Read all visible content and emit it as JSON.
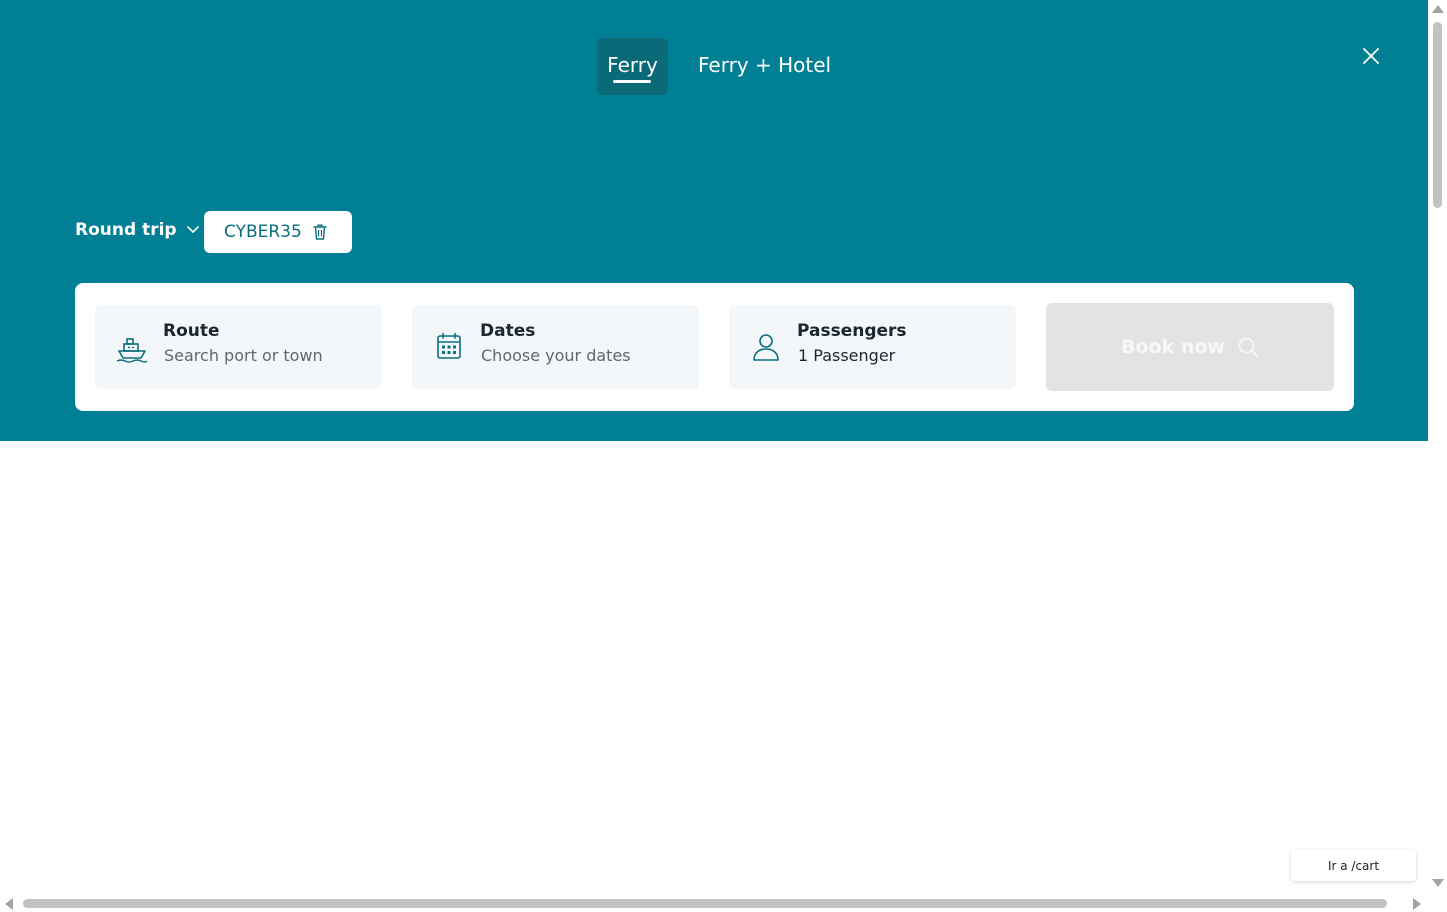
{
  "tabs": {
    "ferry": "Ferry",
    "ferry_hotel": "Ferry + Hotel"
  },
  "trip_type": {
    "selected": "Round trip"
  },
  "promo": {
    "code": "CYBER35"
  },
  "search": {
    "route": {
      "label": "Route",
      "placeholder": "Search port or town",
      "icon": "ship-icon"
    },
    "dates": {
      "label": "Dates",
      "placeholder": "Choose your dates",
      "icon": "calendar-icon"
    },
    "passengers": {
      "label": "Passengers",
      "value": "1 Passenger",
      "icon": "user-icon"
    },
    "book_label": "Book now"
  },
  "cart_link": "Ir a /cart",
  "colors": {
    "brand_teal": "#017f94",
    "active_tab": "#0a6a78",
    "field_bg": "#f3f7fa",
    "disabled_button": "#e3e3e3",
    "icon_teal": "#0b6e7d"
  }
}
